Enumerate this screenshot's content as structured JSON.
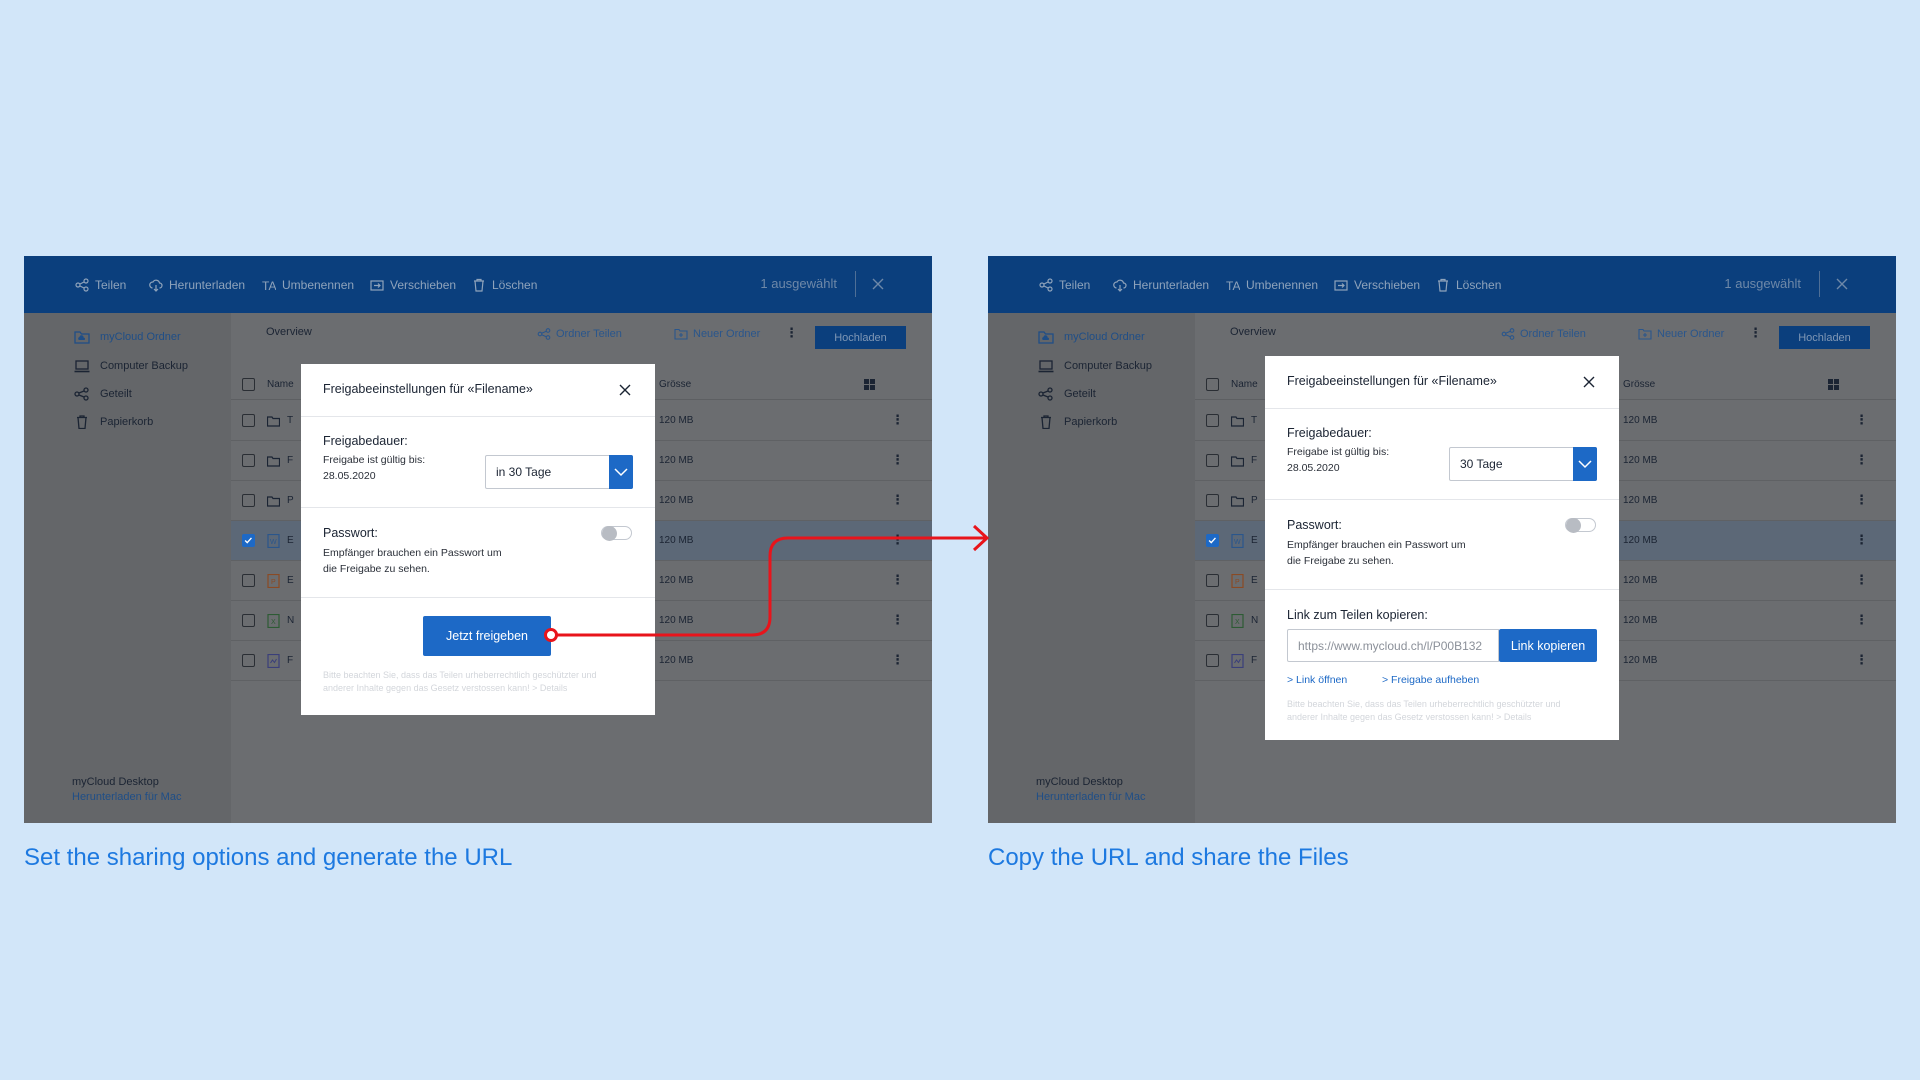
{
  "toolbar": {
    "teilen": "Teilen",
    "herunterladen": "Herunterladen",
    "umbenennen": "Umbenennen",
    "verschieben": "Verschieben",
    "loeschen": "Löschen",
    "selected": "1 ausgewählt"
  },
  "sidebar": {
    "items": [
      "myCloud Ordner",
      "Computer Backup",
      "Geteilt",
      "Papierkorb"
    ],
    "footer_title": "myCloud Desktop",
    "footer_link": "Herunterladen für Mac"
  },
  "main": {
    "title": "Overview",
    "share_folder": "Ordner Teilen",
    "new_folder": "Neuer Ordner",
    "upload": "Hochladen",
    "col_name": "Name",
    "col_size": "Grösse",
    "rows": [
      {
        "name_initial": "T",
        "size": "120 MB"
      },
      {
        "name_initial": "F",
        "size": "120 MB"
      },
      {
        "name_initial": "P",
        "size": "120 MB"
      },
      {
        "name_initial": "E",
        "size": "120 MB"
      },
      {
        "name_initial": "E",
        "size": "120 MB"
      },
      {
        "name_initial": "N",
        "size": "120 MB"
      },
      {
        "name_initial": "F",
        "size": "120 MB"
      }
    ]
  },
  "dialog1": {
    "title": "Freigabeeinstellungen für «Filename»",
    "duration_label": "Freigabedauer:",
    "valid_line1": "Freigabe ist gültig bis:",
    "valid_line2": "28.05.2020",
    "duration_value": "in 30 Tage",
    "password_label": "Passwort:",
    "password_desc1": "Empfänger brauchen ein Passwort um",
    "password_desc2": "die Freigabe zu sehen.",
    "share_button": "Jetzt freigeben",
    "legal1": "Bitte beachten Sie, dass das Teilen urheberrechtlich geschützter und",
    "legal2": "anderer Inhalte gegen das Gesetz verstossen kann! > Details"
  },
  "dialog2": {
    "title": "Freigabeeinstellungen für «Filename»",
    "duration_label": "Freigabedauer:",
    "valid_line1": "Freigabe ist gültig bis:",
    "valid_line2": "28.05.2020",
    "duration_value": "30 Tage",
    "password_label": "Passwort:",
    "password_desc1": "Empfänger brauchen ein Passwort um",
    "password_desc2": "die Freigabe zu sehen.",
    "link_label": "Link zum Teilen kopieren:",
    "url": "https://www.mycloud.ch/l/P00B132",
    "copy_button": "Link kopieren",
    "open_link": "> Link öffnen",
    "remove_share": "> Freigabe aufheben",
    "legal1": "Bitte beachten Sie, dass das Teilen urheberrechtlich geschützter und",
    "legal2": "anderer Inhalte gegen das Gesetz verstossen kann! > Details"
  },
  "captions": {
    "left": "Set the sharing options and generate the URL",
    "right": "Copy the URL and share the Files"
  },
  "colors": {
    "background": "#d2e6f9",
    "toolbar": "#0b3f7d",
    "accent": "#1d69c6",
    "caption": "#1d79e0",
    "arrow": "#e8141b"
  }
}
